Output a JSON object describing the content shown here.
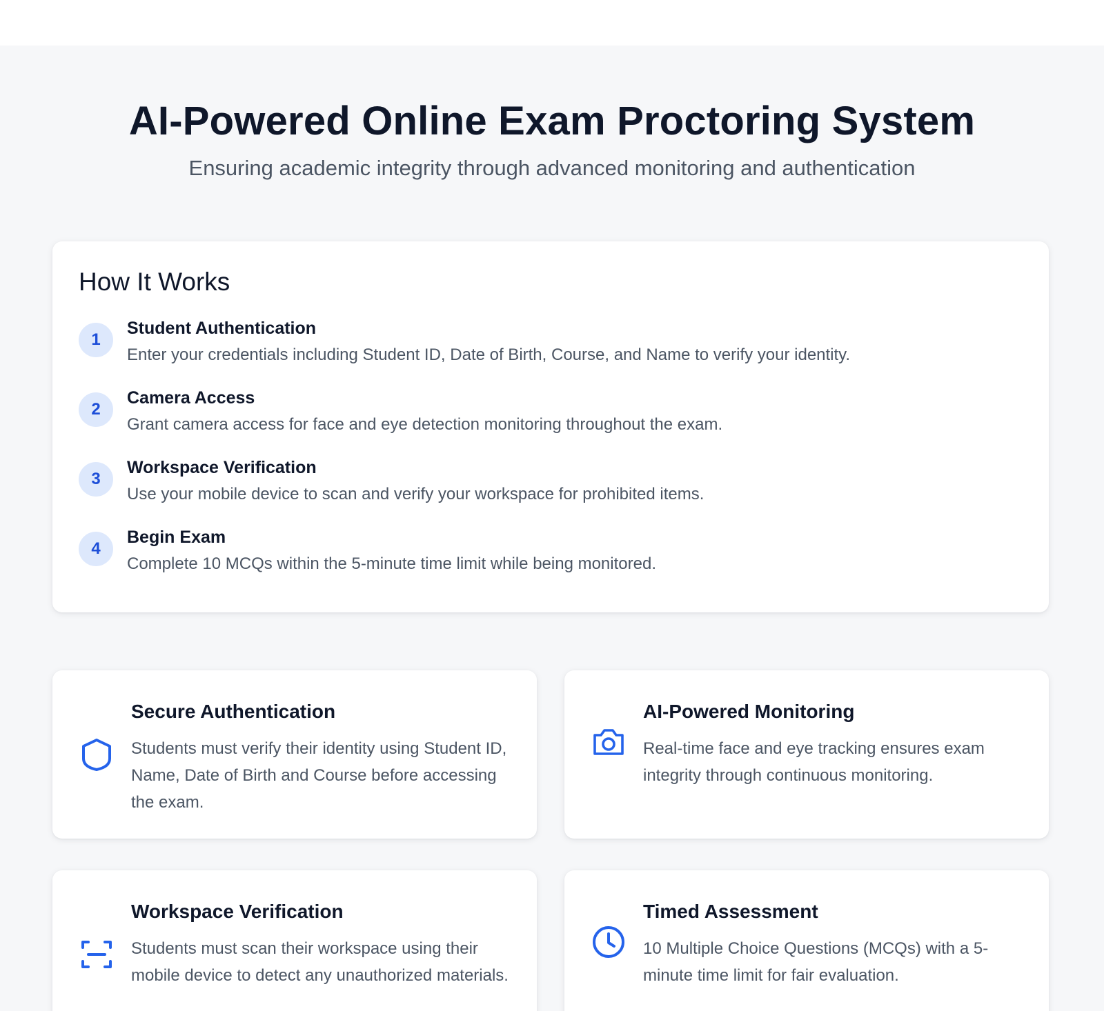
{
  "hero": {
    "title": "AI-Powered Online Exam Proctoring System",
    "subtitle": "Ensuring academic integrity through advanced monitoring and authentication"
  },
  "how_it_works": {
    "title": "How It Works",
    "steps": [
      {
        "number": "1",
        "title": "Student Authentication",
        "description": "Enter your credentials including Student ID, Date of Birth, Course, and Name to verify your identity."
      },
      {
        "number": "2",
        "title": "Camera Access",
        "description": "Grant camera access for face and eye detection monitoring throughout the exam."
      },
      {
        "number": "3",
        "title": "Workspace Verification",
        "description": "Use your mobile device to scan and verify your workspace for prohibited items."
      },
      {
        "number": "4",
        "title": "Begin Exam",
        "description": "Complete 10 MCQs within the 5-minute time limit while being monitored."
      }
    ]
  },
  "features": [
    {
      "icon": "shield-icon",
      "title": "Secure Authentication",
      "description": "Students must verify their identity using Student ID, Name, Date of Birth and Course before accessing the exam."
    },
    {
      "icon": "camera-icon",
      "title": "AI-Powered Monitoring",
      "description": "Real-time face and eye tracking ensures exam integrity through continuous monitoring."
    },
    {
      "icon": "scan-icon",
      "title": "Workspace Verification",
      "description": "Students must scan their workspace using their mobile device to detect any unauthorized materials."
    },
    {
      "icon": "clock-icon",
      "title": "Timed Assessment",
      "description": "10 Multiple Choice Questions (MCQs) with a 5-minute time limit for fair evaluation."
    }
  ],
  "colors": {
    "accent": "#2563eb",
    "step_badge_bg": "#dde8fc",
    "page_bg": "#f6f7f9",
    "heading": "#0f172a",
    "body_text": "#4b5563"
  }
}
